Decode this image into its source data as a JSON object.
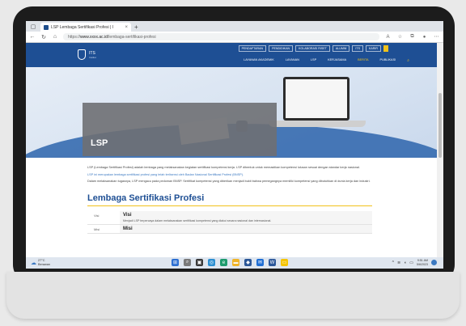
{
  "browser": {
    "tab_title": "LSP Lembaga Sertifikasi Profesi | I",
    "tab_close": "×",
    "new_tab": "+",
    "url_prefix": "https://",
    "url_host": "www.xxxx.ac.id",
    "url_path": "/lembaga-sertifikasi-profesi"
  },
  "site": {
    "logo_name": "ITS",
    "logo_sub": "Institut",
    "topnav": [
      "PENDAFTARAN",
      "PENDIDIKAN",
      "KOLABORASI RISET",
      "ALUMNI",
      "ITS",
      "KARIR"
    ],
    "mainnav": [
      "LAYANAN AKADEMIK",
      "LAYANAN",
      "LSP",
      "KERJASAMA",
      "BERITA",
      "PUBLIKASI"
    ],
    "hero_title": "LSP",
    "paragraphs": [
      "LSP (Lembaga Sertifikasi Profesi) adalah lembaga yang melaksanakan kegiatan sertifikasi kompetensi kerja. LSP dibentuk untuk memastikan kompetensi lulusan sesuai dengan standar kerja nasional.",
      "LSP ini merupakan lembaga sertifikasi profesi yang telah terlisensi oleh Badan Nasional Sertifikasi Profesi (BNSP).",
      "Dalam melaksanakan tugasnya, LSP mengacu pada pedoman BNSP. Sertifikat kompetensi yang diberikan menjadi bukti bahwa pemegangnya memiliki kompetensi yang dibutuhkan di dunia kerja dan industri."
    ],
    "section_title": "Lembaga Sertifikasi Profesi",
    "vm_rows": [
      {
        "key": "Visi",
        "head": "Visi",
        "desc": "Menjadi LSP terpercaya dalam melaksanakan sertifikasi kompetensi yang diakui secara nasional dan internasional."
      },
      {
        "key": "Misi",
        "head": "Misi",
        "desc": ""
      }
    ]
  },
  "taskbar": {
    "weather_temp": "27°C",
    "weather_cond": "Berawan",
    "time": "9:51 AM",
    "date": "5/6/2023",
    "accent": "#3b79c2"
  }
}
